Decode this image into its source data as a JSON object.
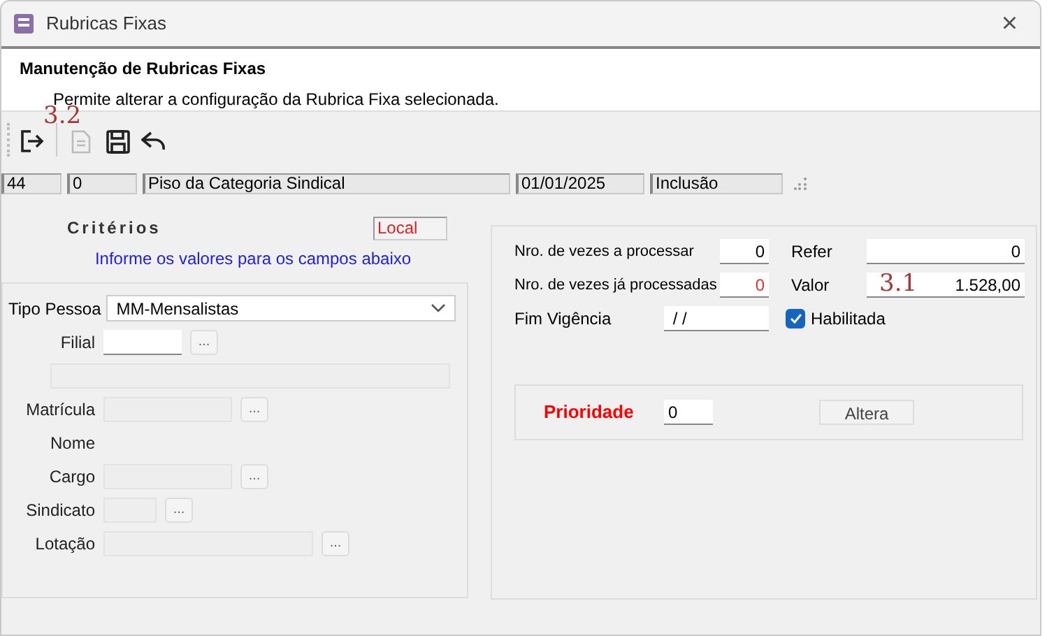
{
  "window": {
    "title": "Rubricas Fixas",
    "close": "×"
  },
  "header": {
    "title": "Manutenção de Rubricas Fixas",
    "description": "Permite alterar a configuração da Rubrica Fixa selecionada."
  },
  "toolbar": {
    "annotation": "3.2",
    "buttons": [
      {
        "kind": "exit",
        "disabled": false
      },
      {
        "kind": "document",
        "disabled": true
      },
      {
        "kind": "save",
        "disabled": false
      },
      {
        "kind": "undo",
        "disabled": false
      }
    ]
  },
  "info_bar": [
    "44",
    "0",
    "Piso da Categoria Sindical",
    "01/01/2025",
    "Inclusão"
  ],
  "criteria": {
    "title": "Critérios",
    "badge": "Local",
    "hint": "Informe os valores para os campos abaixo",
    "tipo_pessoa": {
      "label": "Tipo Pessoa",
      "value": "MM-Mensalistas"
    },
    "fields": [
      {
        "kind": "lookup",
        "label": "Filial",
        "disabled": false,
        "button": "..."
      },
      {
        "kind": "wide",
        "disabled": true
      },
      {
        "kind": "lookup",
        "label": "Matrícula",
        "disabled": true,
        "button": "..."
      },
      {
        "kind": "text",
        "label": "Nome"
      },
      {
        "kind": "lookup",
        "label": "Cargo",
        "disabled": true,
        "button": "..."
      },
      {
        "kind": "lookup",
        "label": "Sindicato",
        "disabled": true,
        "button": "..."
      },
      {
        "kind": "lookup",
        "label": "Lotação",
        "disabled": true,
        "button": "..."
      }
    ]
  },
  "details": {
    "rows": [
      {
        "label": "Nro. de vezes a processar",
        "value": "0",
        "alert": false,
        "side_label": "Refer",
        "side_value": "0"
      },
      {
        "label": "Nro. de vezes já processadas",
        "value": "0",
        "alert": true,
        "side_label": "Valor",
        "side_value": "1.528,00",
        "annotation": "3.1"
      }
    ],
    "fim_vigencia": {
      "label": "Fim Vigência",
      "value": " / /"
    },
    "habilitada": {
      "label": "Habilitada",
      "checked": true
    },
    "prioridade": {
      "label": "Prioridade",
      "value": "0",
      "button": "Altera"
    }
  }
}
